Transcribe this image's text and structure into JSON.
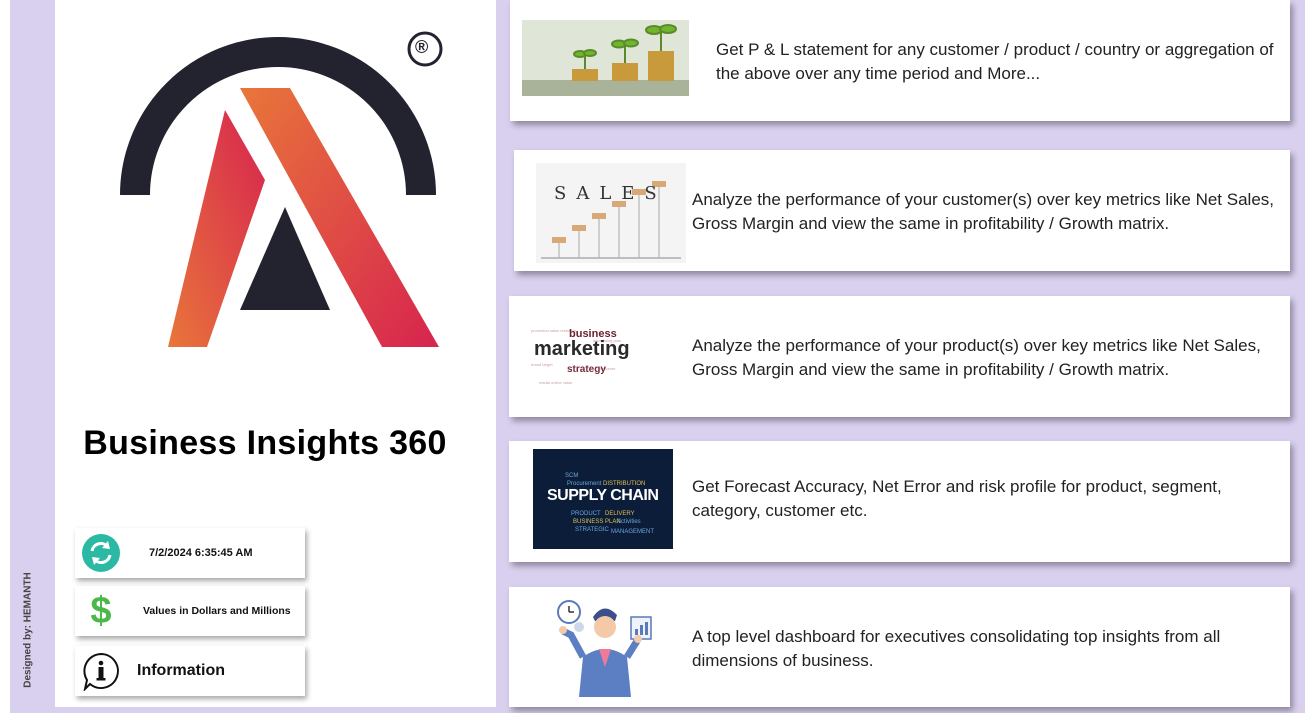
{
  "sidebar": {
    "designer_credit": "Designed by: HEMANTH"
  },
  "app": {
    "title": "Business Insights 360",
    "registered_mark": "®"
  },
  "info": {
    "refresh_time": "7/2/2024 6:35:45 AM",
    "currency_note": "Values in Dollars and Millions",
    "information_label": "Information"
  },
  "features": [
    {
      "thumbnail": "coin-plants-image",
      "description": "Get P & L statement for any customer / product / country or aggregation of the above over any time period and More..."
    },
    {
      "thumbnail": "sales-steps-image",
      "thumb_text": "SALES",
      "description": "Analyze the performance of your customer(s) over key metrics like Net Sales, Gross Margin and view the same in profitability / Growth matrix."
    },
    {
      "thumbnail": "marketing-wordcloud-image",
      "thumb_text": [
        "business",
        "marketing",
        "strategy"
      ],
      "description": "Analyze the performance of your product(s) over key metrics like Net Sales, Gross Margin and view the same in profitability / Growth matrix."
    },
    {
      "thumbnail": "supply-chain-image",
      "thumb_text": "SUPPLY CHAIN",
      "description": "Get Forecast Accuracy, Net Error and risk profile for product, segment, category, customer etc."
    },
    {
      "thumbnail": "executive-illustration",
      "description": "A top level dashboard for executives consolidating top insights from all dimensions of business."
    }
  ],
  "colors": {
    "background": "#d9d0ef",
    "logo_dark": "#23232f",
    "logo_gradient_start": "#e8763a",
    "logo_gradient_end": "#d7244f",
    "refresh_icon": "#2bb9a4",
    "dollar_icon": "#4cb84a"
  }
}
